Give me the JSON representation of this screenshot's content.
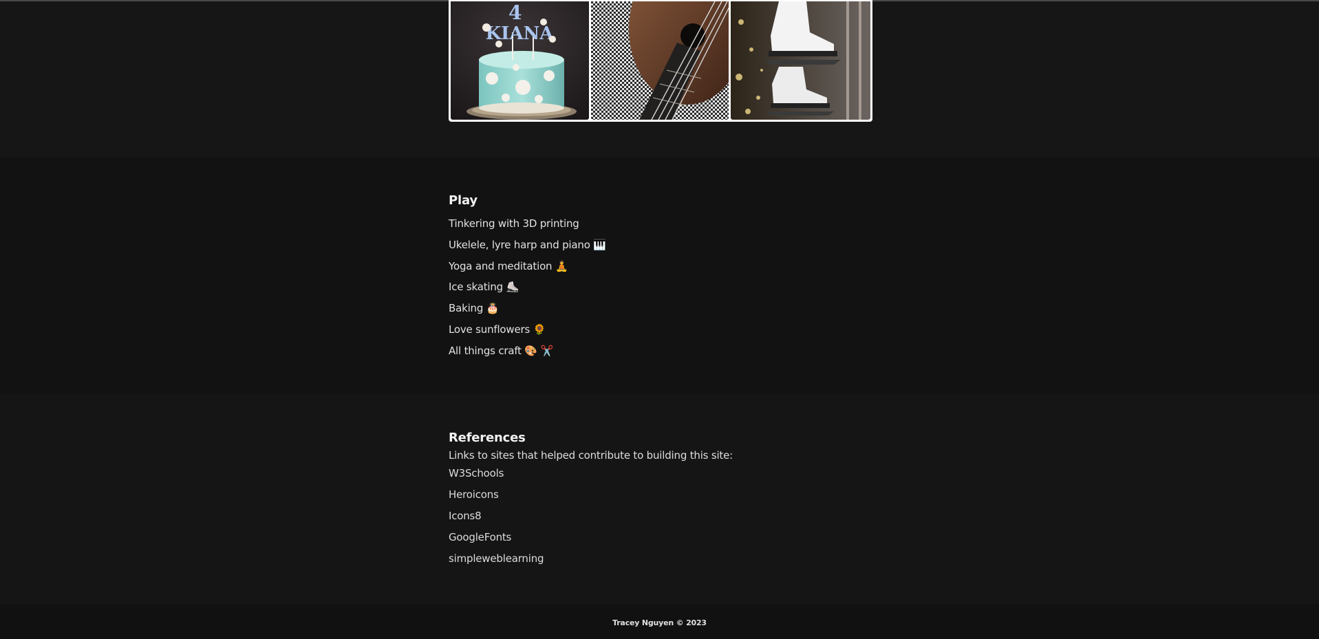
{
  "gallery": {
    "photos": [
      {
        "subject": "snowflake birthday cake",
        "icon": "cake-photo",
        "cake_topper": "KIANA"
      },
      {
        "subject": "ukulele on houndstooth fabric",
        "icon": "ukulele-photo"
      },
      {
        "subject": "white ice skates with bokeh lights",
        "icon": "ice-skates-photo"
      }
    ]
  },
  "play": {
    "heading": "Play",
    "items": [
      {
        "text": "Tinkering with 3D printing",
        "emoji": ""
      },
      {
        "text": "Ukelele, lyre harp and piano",
        "emoji": "🎹"
      },
      {
        "text": "Yoga and meditation",
        "emoji": "🧘"
      },
      {
        "text": "Ice skating",
        "emoji": "⛸️"
      },
      {
        "text": "Baking",
        "emoji": "🎂"
      },
      {
        "text": "Love sunflowers",
        "emoji": "🌻"
      },
      {
        "text": "All things craft",
        "emoji": "🎨 ✂️"
      }
    ]
  },
  "references": {
    "heading": "References",
    "intro": "Links to sites that helped contribute to building this site:",
    "links": [
      "W3Schools",
      "Heroicons",
      "Icons8",
      "GoogleFonts",
      "simpleweblearning"
    ]
  },
  "footer": {
    "text": "Tracey Nguyen © 2023"
  },
  "colors": {
    "background": "#141414",
    "text": "#e8e8e8",
    "gallery_frame": "#ffffff"
  }
}
